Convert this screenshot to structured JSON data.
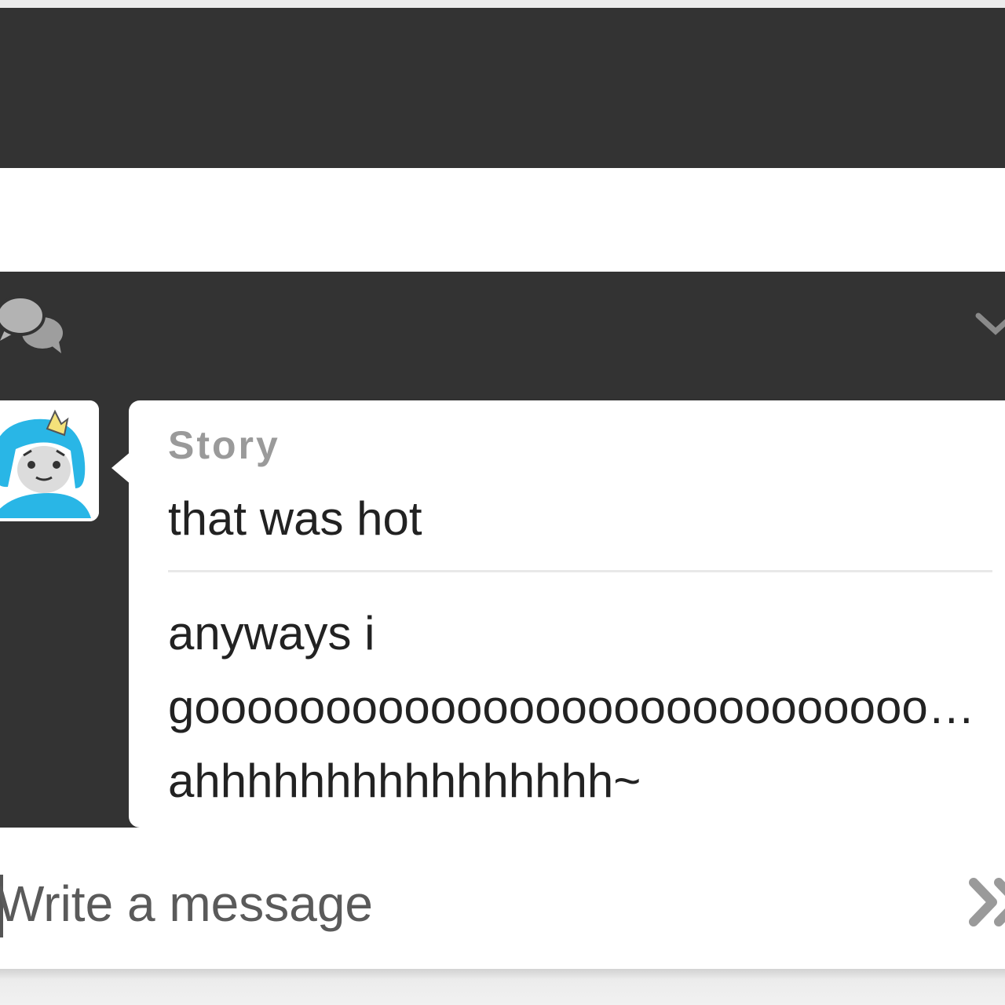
{
  "app": {
    "colors": {
      "panel_bg": "#333333",
      "bubble_bg": "#ffffff",
      "sender_color": "#9a9a9a",
      "avatar_accent": "#29b6e6"
    }
  },
  "chat": {
    "header": {
      "left_icon": "chat-bubbles-icon",
      "right_icon": "chevron-down-icon"
    },
    "message": {
      "avatar_icon": "user-avatar",
      "sender": "Story",
      "first_text": "that was hot",
      "second_lines": [
        "anyways i",
        "goooooooooooooooooooooooooooooooo…",
        "ahhhhhhhhhhhhhhhh~"
      ]
    }
  },
  "composer": {
    "placeholder": "Write a message",
    "value": "",
    "send_icon": "send-icon"
  }
}
